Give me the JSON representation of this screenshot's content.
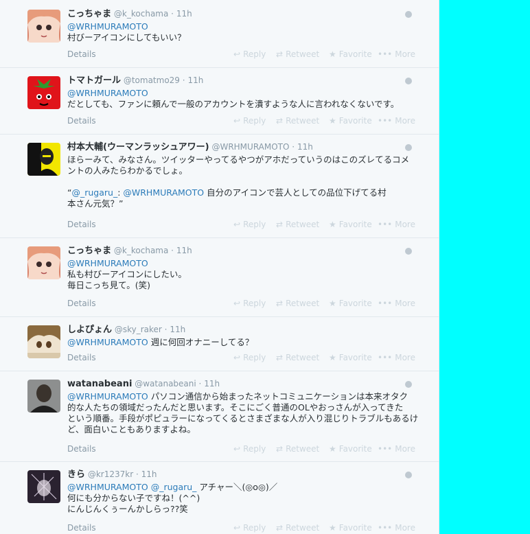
{
  "actions": {
    "details": "Details",
    "reply": "Reply",
    "retweet": "Retweet",
    "favorite": "Favorite",
    "more": "More"
  },
  "tweets": [
    {
      "name": "こっちゃま",
      "handle": "@k_kochama",
      "dot": "·",
      "time": "11h",
      "avatar": "avatar-pink-haired-girl",
      "mention": "@WRHMURAMOTO",
      "lines": [
        "村びーアイコンにしてもいい？"
      ]
    },
    {
      "name": "トマトガール",
      "handle": "@tomatmo29",
      "dot": "·",
      "time": "11h",
      "avatar": "avatar-tomato",
      "mention": "@WRHMURAMOTO",
      "lines": [
        "だとしても、ファンに頼んで一般のアカウントを潰すような人に言われなくないです。"
      ]
    },
    {
      "name": "村本大輔(ウーマンラッシュアワー)",
      "handle": "@WRHMURAMOTO",
      "dot": "·",
      "time": "11h",
      "avatar": "avatar-yellow-portrait",
      "line1": "ほらーみて、みなさん。ツイッターやってるやつがアホだっていうのはこのズレてるコメ",
      "line2": "ントの人みたらわかるでしょ。",
      "quote_open": "“",
      "quote_mention1": "@_rugaru_",
      "quote_colon": ": ",
      "quote_mention2": "@WRHMURAMOTO",
      "quote_text": " 自分のアイコンで芸人としての品位下げてる村",
      "quote_line2": "本さん元気？”"
    },
    {
      "name": "こっちゃま",
      "handle": "@k_kochama",
      "dot": "·",
      "time": "11h",
      "avatar": "avatar-pink-haired-girl",
      "mention": "@WRHMURAMOTO",
      "lines": [
        "私も村びーアイコンにしたい。",
        "毎日こっち見て。(笑)"
      ]
    },
    {
      "name": "しよぴょん",
      "handle": "@sky_raker",
      "dot": "·",
      "time": "11h",
      "avatar": "avatar-anime-boy",
      "mention": "@WRHMURAMOTO",
      "inline": " 週に何回オナニーしてる？"
    },
    {
      "name": "watanabeani",
      "handle": "@watanabeani",
      "dot": "·",
      "time": "11h",
      "avatar": "avatar-man-photo",
      "mention": "@WRHMURAMOTO",
      "inline": "  パソコン通信から始まったネットコミュニケーションは本来オタク",
      "lines": [
        "的な人たちの領域だったんだと思います。そこにごく普通のOLやおっさんが入ってきた",
        "という順番。手段がポピュラーになってくるとさまざまな人が入り混じりトラブルもあるけ",
        "ど、面白いこともありますよね。"
      ]
    },
    {
      "name": "きら",
      "handle": "@kr1237kr",
      "dot": "·",
      "time": "11h",
      "avatar": "avatar-dark-sketch",
      "mention": "@WRHMURAMOTO",
      "mention2": " @_rugaru_",
      "inline": " アチャー＼(◎o◎)／",
      "lines": [
        "何にも分からない子ですね！(^^)",
        "にんじんくぅーんかしらっ??笑"
      ]
    }
  ]
}
